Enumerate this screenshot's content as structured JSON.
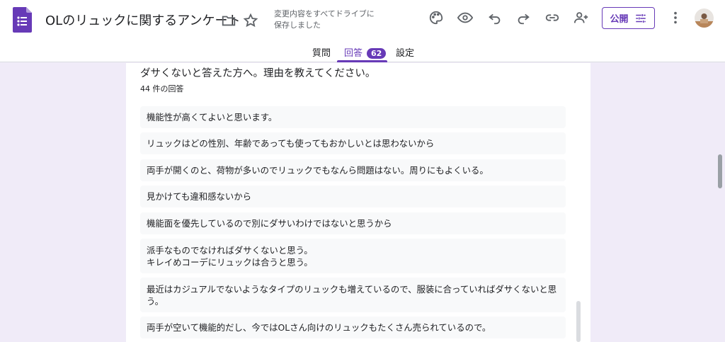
{
  "header": {
    "title": "OLのリュックに関するアンケート",
    "saved_line1": "変更内容をすべてドライブに",
    "saved_line2": "保存しました",
    "publish_label": "公開"
  },
  "tabs": [
    {
      "label": "質問"
    },
    {
      "label": "回答",
      "badge": "62"
    },
    {
      "label": "設定"
    }
  ],
  "question": {
    "title": "ダサくないと答えた方へ。理由を教えてください。",
    "count": "44 件の回答"
  },
  "responses": [
    {
      "line1": "機能性が高くてよいと思います。",
      "line2": ""
    },
    {
      "line1": "リュックはどの性別、年齢であっても使ってもおかしいとは思わないから",
      "line2": ""
    },
    {
      "line1": "両手が開くのと、荷物が多いのでリュックでもなんら問題はない。周りにもよくいる。",
      "line2": ""
    },
    {
      "line1": "見かけても違和感ないから",
      "line2": ""
    },
    {
      "line1": "機能面を優先しているので別にダサいわけではないと思うから",
      "line2": ""
    },
    {
      "line1": "派手なものでなければダサくないと思う。",
      "line2": "キレイめコーデにリュックは合うと思う。"
    },
    {
      "line1": "最近はカジュアルでないようなタイプのリュックも増えているので、服装に合っていればダサくないと思",
      "line2": "う。"
    },
    {
      "line1": "両手が空いて機能的だし、今ではOLさん向けのリュックもたくさん売られているので。",
      "line2": ""
    }
  ],
  "colors": {
    "accent": "#673ab7",
    "background": "#f0ebf8"
  }
}
